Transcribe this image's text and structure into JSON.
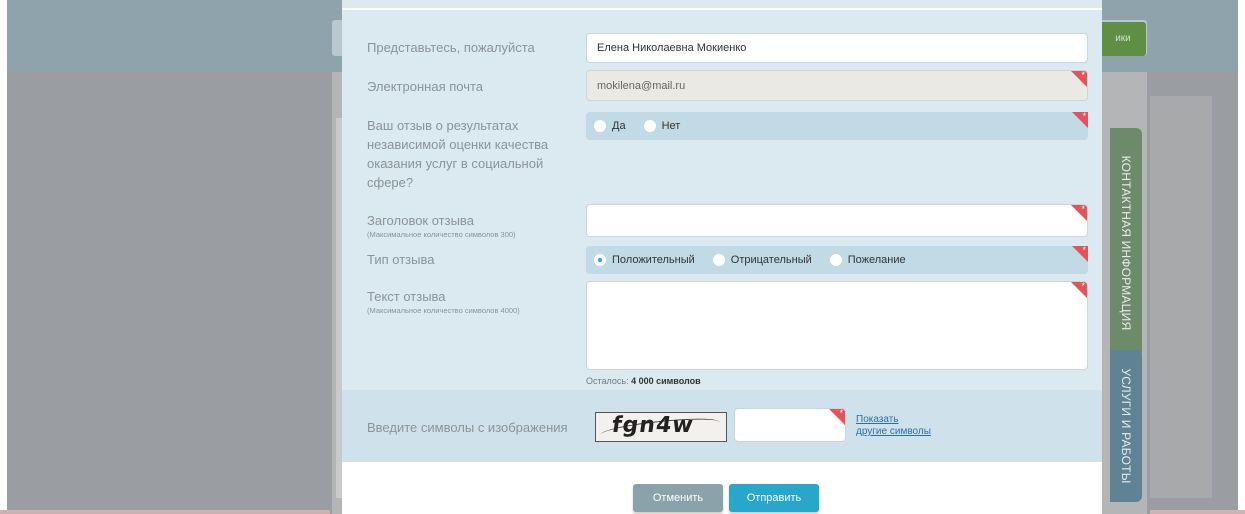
{
  "background": {
    "green_button_label": "ики",
    "side_tabs": [
      "КОНТАКТНАЯ ИНФОРМАЦИЯ",
      "УСЛУГИ И РАБОТЫ"
    ]
  },
  "form": {
    "name": {
      "label": "Представьтесь, пожалуйста",
      "value": "Елена Николаевна Мокиенко"
    },
    "email": {
      "label": "Электронная почта",
      "value": "mokilena@mail.ru"
    },
    "independent_review": {
      "label": "Ваш отзыв о результатах независимой оценки качества оказания услуг в социальной сфере?",
      "options": [
        "Да",
        "Нет"
      ],
      "selected": null
    },
    "title": {
      "label": "Заголовок отзыва",
      "hint": "(Максимальное количество символов 300)",
      "value": ""
    },
    "type": {
      "label": "Тип отзыва",
      "options": [
        "Положительный",
        "Отрицательный",
        "Пожелание"
      ],
      "selected": "Положительный"
    },
    "text": {
      "label": "Текст отзыва",
      "hint": "(Максимальное количество символов 4000)",
      "value": ""
    },
    "counter": {
      "prefix": "Осталось:",
      "value": "4 000 символов"
    },
    "captcha": {
      "label": "Введите символы с изображения",
      "image_text": "fgn4w",
      "input_value": "",
      "link_line1": "Показать",
      "link_line2": "другие символы"
    }
  },
  "buttons": {
    "cancel": "Отменить",
    "send": "Отправить"
  },
  "colors": {
    "accent": "#27a7cc",
    "required": "#e2545a",
    "modal_bg": "#dbe9f0"
  }
}
